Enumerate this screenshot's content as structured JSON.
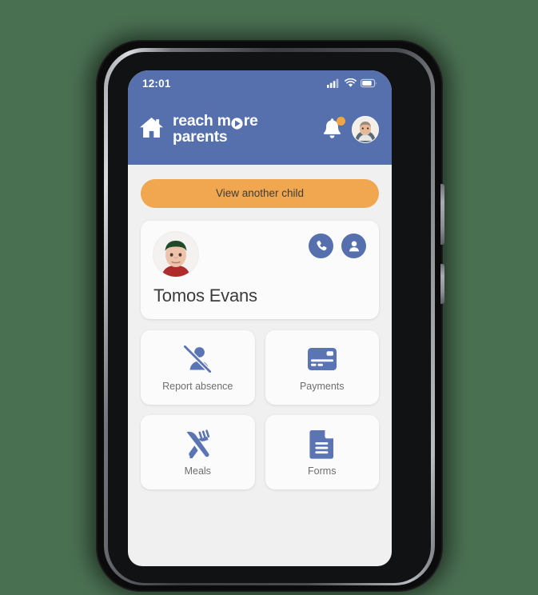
{
  "theme": {
    "page_background": "#4a7052",
    "header_blue": "#5570ad",
    "accent_orange": "#f0a74f",
    "badge_orange": "#f0a742",
    "icon_blue": "#5a74b4",
    "screen_background": "#f0f0f0",
    "card_background": "#fbfbfb",
    "label_gray": "#6e6e6e"
  },
  "status_bar": {
    "time": "12:01",
    "icons": [
      "signal-icon",
      "wifi-icon",
      "battery-icon"
    ]
  },
  "app_bar": {
    "home_icon": "home-icon",
    "brand_line_1_a": "reach m",
    "brand_line_1_b": "re",
    "brand_line_2": "parents",
    "brand_full": "reach more parents",
    "notifications_icon": "bell-icon",
    "notification_badge": "",
    "avatar": "user-avatar"
  },
  "main": {
    "view_another_child_label": "View another child",
    "child": {
      "name": "Tomos Evans",
      "avatar": "child-avatar",
      "actions": [
        {
          "name": "call-button",
          "icon": "phone-icon"
        },
        {
          "name": "profile-button",
          "icon": "person-icon"
        }
      ]
    },
    "tiles": [
      {
        "label": "Report absence",
        "icon": "person-slash-icon"
      },
      {
        "label": "Payments",
        "icon": "credit-card-icon"
      },
      {
        "label": "Meals",
        "icon": "cutlery-icon"
      },
      {
        "label": "Forms",
        "icon": "document-icon"
      }
    ]
  }
}
